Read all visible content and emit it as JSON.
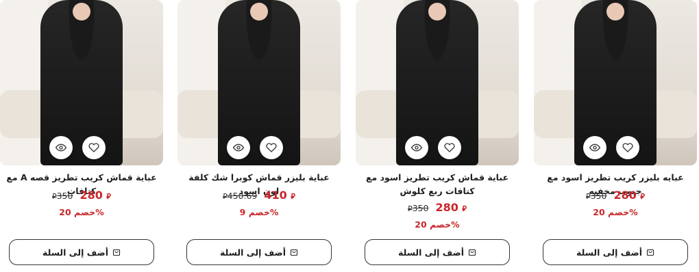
{
  "currency_symbol": "⃁",
  "products": [
    {
      "title": "عباية قماش كريب تطريز قصه A مع كتافات",
      "price_old": "350",
      "price_new": "280",
      "discount": "خصم 20%",
      "add_label": "أضف إلى السلة"
    },
    {
      "title": "عباية بليزر قماش كوبرا شك كلفة لون اسود",
      "price_old": "450.69",
      "price_new": "410",
      "discount": "خصم 9%",
      "add_label": "أضف إلى السلة"
    },
    {
      "title": "عباية قماش كريب تطريز اسود مع كتافات ربع كلوش",
      "price_old": "350",
      "price_new": "280",
      "discount": "خصم 20%",
      "add_label": "أضف إلى السلة"
    },
    {
      "title": "عبايه بليزر كريب تطريز اسود مع جيوب مخفيه",
      "price_old": "350",
      "price_new": "280",
      "discount": "خصم 20%",
      "add_label": "أضف إلى السلة"
    }
  ],
  "icons": {
    "view": "eye-icon",
    "wishlist": "heart-icon",
    "cart": "cart-icon"
  },
  "colors": {
    "price": "#c9262b",
    "text": "#1e1e1e"
  }
}
